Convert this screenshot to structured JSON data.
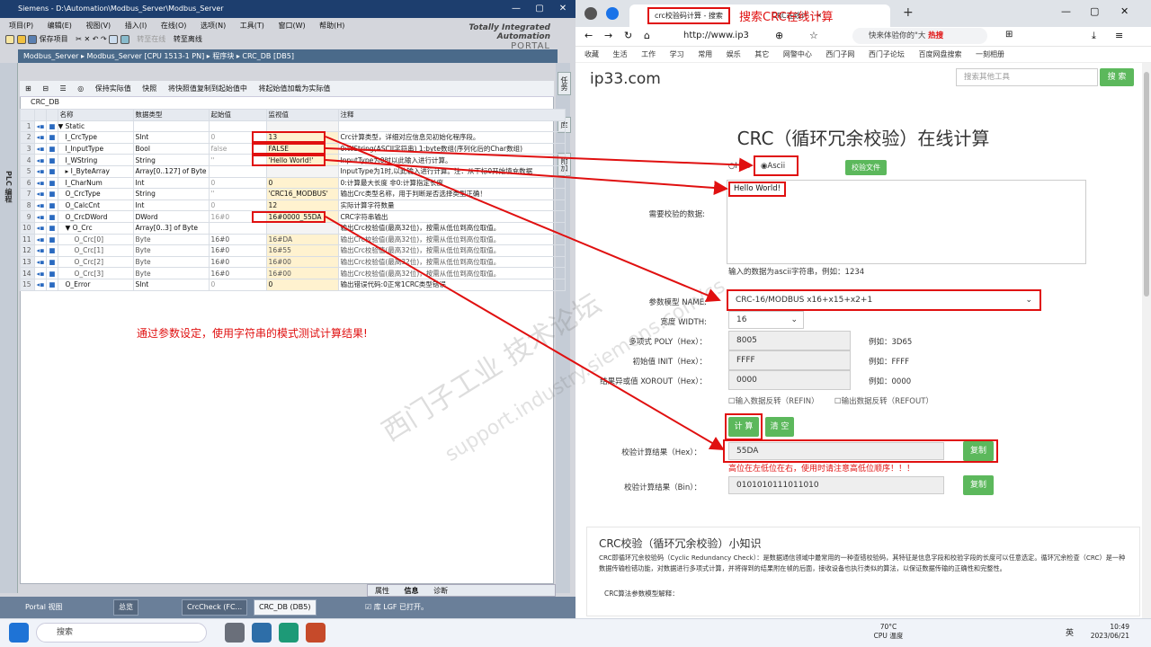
{
  "tia": {
    "title": "Siemens  -  D:\\Automation\\Modbus_Server\\Modbus_Server",
    "menu": [
      "项目(P)",
      "编辑(E)",
      "视图(V)",
      "插入(I)",
      "在线(O)",
      "选项(N)",
      "工具(T)",
      "窗口(W)",
      "帮助(H)"
    ],
    "save_label": "保存项目",
    "go_online": "转至在线",
    "go_offline": "转至离线",
    "brand_line1": "Totally Integrated Automation",
    "brand_line2": "PORTAL",
    "breadcrumb": "Modbus_Server  ▸  Modbus_Server [CPU 1513-1 PN]  ▸  程序块  ▸  CRC_DB [DB5]",
    "left_tab": "PLC 编程",
    "right_tabs": [
      "任务",
      "库",
      "附加"
    ],
    "editor_tools": {
      "keep_actual": "保持实际值",
      "snapshot": "快照",
      "copy_snapshot": "将快照值复制到起始值中",
      "load_start": "将起始值加载为实际值"
    },
    "db_name": "CRC_DB",
    "columns": [
      "名称",
      "数据类型",
      "起始值",
      "监视值",
      "注释"
    ],
    "rows": [
      {
        "n": "1",
        "name": "▼ Static",
        "type": "",
        "start": "",
        "monitor": "",
        "comment": ""
      },
      {
        "n": "2",
        "name": "I_CrcType",
        "type": "SInt",
        "start": "0",
        "monitor": "13",
        "comment": "Crc计算类型，详细对应信息见初始化程序段。"
      },
      {
        "n": "3",
        "name": "I_InputType",
        "type": "Bool",
        "start": "false",
        "monitor": "FALSE",
        "comment": "0:WString(ASCII字符串) 1:byte数组(序列化后的Char数组)"
      },
      {
        "n": "4",
        "name": "I_WString",
        "type": "String",
        "start": "''",
        "monitor": "'Hello World!'",
        "comment": "InputType为0时以此输入进行计算。"
      },
      {
        "n": "5",
        "name": "▸ I_ByteArray",
        "type": "Array[0..127] of Byte",
        "start": "",
        "monitor": "",
        "comment": "InputType为1时,以此输入进行计算。注：从下标0开始填充数据"
      },
      {
        "n": "6",
        "name": "I_CharNum",
        "type": "Int",
        "start": "0",
        "monitor": "0",
        "comment": "0:计算最大长度 非0:计算指定长度"
      },
      {
        "n": "7",
        "name": "O_CrcType",
        "type": "String",
        "start": "''",
        "monitor": "'CRC16_MODBUS'",
        "comment": "输出Crc类型名称，用于判断是否选择类型正确！"
      },
      {
        "n": "8",
        "name": "O_CalcCnt",
        "type": "Int",
        "start": "0",
        "monitor": "12",
        "comment": "实际计算字符数量"
      },
      {
        "n": "9",
        "name": "O_CrcDWord",
        "type": "DWord",
        "start": "16#0",
        "monitor": "16#0000_55DA",
        "comment": "CRC字符串输出"
      },
      {
        "n": "10",
        "name": "▼ O_Crc",
        "type": "Array[0..3] of Byte",
        "start": "",
        "monitor": "",
        "comment": "输出Crc校验值(最高32位)，按需从低位到高位取值。"
      },
      {
        "n": "11",
        "name": "O_Crc[0]",
        "type": "Byte",
        "start": "16#0",
        "monitor": "16#DA",
        "comment": "输出Crc校验值(最高32位)，按需从低位到高位取值。"
      },
      {
        "n": "12",
        "name": "O_Crc[1]",
        "type": "Byte",
        "start": "16#0",
        "monitor": "16#55",
        "comment": "输出Crc校验值(最高32位)，按需从低位到高位取值。"
      },
      {
        "n": "13",
        "name": "O_Crc[2]",
        "type": "Byte",
        "start": "16#0",
        "monitor": "16#00",
        "comment": "输出Crc校验值(最高32位)，按需从低位到高位取值。"
      },
      {
        "n": "14",
        "name": "O_Crc[3]",
        "type": "Byte",
        "start": "16#0",
        "monitor": "16#00",
        "comment": "输出Crc校验值(最高32位)，按需从低位到高位取值。"
      },
      {
        "n": "15",
        "name": "O_Error",
        "type": "SInt",
        "start": "0",
        "monitor": "0",
        "comment": "输出错误代码:0正常1CRC类型错误"
      }
    ],
    "note": "通过参数设定，使用字符串的模式测试计算结果!",
    "bottom_tabs": [
      "属性",
      "信息",
      "诊断"
    ],
    "status": {
      "portal": "Portal 视图",
      "tasks": [
        "总览",
        "CrcCheck (FC...",
        "CRC_DB (DB5)"
      ],
      "lib": "库 LGF 已打开。"
    }
  },
  "browser": {
    "tab_title": "crc校验码计算 - 搜索",
    "tab2": "CRC在线计",
    "annotation": "搜索CRC在线计算",
    "url": "http://www.ip3",
    "search_hint": "快来体验你的\"大",
    "hot": "热搜",
    "bookmarks": [
      "收藏",
      "生活",
      "工作",
      "学习",
      "常用",
      "娱乐",
      "其它",
      "网警中心",
      "西门子网",
      "西门子论坛",
      "百度网盘搜索",
      "一刻相册"
    ],
    "site": {
      "logo": "ip33.com",
      "search_placeholder": "搜索其他工具",
      "search_btn": "搜 索",
      "title": "CRC（循环冗余校验）在线计算",
      "hex": "Hex",
      "ascii": "Ascii",
      "check_file": "校验文件",
      "data_label": "需要校验的数据:",
      "data_value": "Hello World!",
      "data_hint": "输入的数据为ascii字符串，例如：1234",
      "model_label": "参数模型 NAME:",
      "model_value": "CRC-16/MODBUS            x16+x15+x2+1",
      "width_label": "宽度 WIDTH:",
      "width_value": "16",
      "poly_label": "多项式 POLY（Hex）：",
      "poly_value": "8005",
      "poly_eg": "例如：3D65",
      "init_label": "初始值 INIT（Hex）：",
      "init_value": "FFFF",
      "init_eg": "例如：FFFF",
      "xor_label": "结果异或值 XOROUT（Hex）：",
      "xor_value": "0000",
      "xor_eg": "例如：0000",
      "refin": "输入数据反转（REFIN）",
      "refout": "输出数据反转（REFOUT）",
      "calc_btn": "计 算",
      "clear_btn": "清 空",
      "hex_result_label": "校验计算结果（Hex）：",
      "hex_result": "55DA",
      "copy_btn": "复制",
      "red_note": "高位在左低位在右，使用时请注意高低位顺序！！！",
      "bin_result_label": "校验计算结果（Bin）：",
      "bin_result": "0101010111011010",
      "know_title": "CRC校验（循环冗余校验）小知识",
      "know_text": "CRC即循环冗余校验码（Cyclic Redundancy Check）：是数据通信领域中最常用的一种查错校验码，其特征是信息字段和校验字段的长度可以任意选定。循环冗余检查（CRC）是一种数据传输检错功能，对数据进行多项式计算，并将得到的结果附在帧的后面，接收设备也执行类似的算法，以保证数据传输的正确性和完整性。",
      "know_sub": "CRC算法参数模型解释："
    },
    "watermark1": "西门子工业 技术论坛",
    "watermark2": "support.industry.siemens.com/cs"
  },
  "taskbar": {
    "search": "搜索",
    "temp": "70°C",
    "temp_label": "CPU 温度",
    "lang": "英",
    "time": "10:49",
    "date": "2023/06/21"
  }
}
